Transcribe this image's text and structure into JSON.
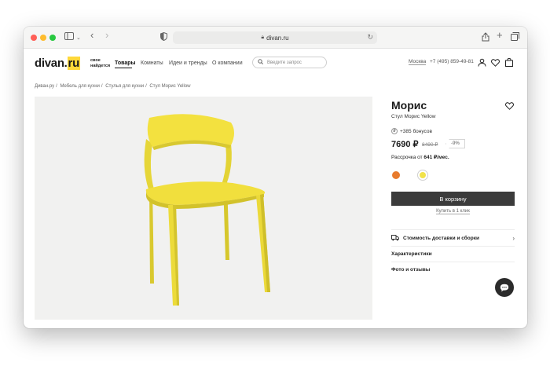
{
  "browser": {
    "url": "divan.ru"
  },
  "header": {
    "logo_main": "divan.",
    "logo_tld": "ru",
    "slogan_line1": "свое",
    "slogan_line2": "найдется",
    "nav": [
      "Товары",
      "Комнаты",
      "Идеи и тренды",
      "О компании"
    ],
    "search_placeholder": "Введите запрос",
    "city": "Москва",
    "phone": "+7 (495) 859-49-81"
  },
  "breadcrumb": [
    "Диван.ру",
    "Мебель для кухни",
    "Стулья для кухни",
    "Стул Морис Yellow"
  ],
  "product": {
    "title": "Морис",
    "subtitle": "Стул Морис Yellow",
    "bonus": "+385 бонусов",
    "price": "7690 ₽",
    "old_price": "8490 ₽",
    "discount": "-9%",
    "installment_prefix": "Рассрочка от ",
    "installment_value": "641 ₽/мес.",
    "swatch_colors": [
      "#e87b2d",
      "#ffffff",
      "#f1e24a"
    ],
    "cart_button": "В корзину",
    "one_click": "Купить в 1 клик",
    "delivery_label": "Стоимость доставки и сборки",
    "specs_label": "Характеристики",
    "reviews_label": "Фото и отзывы"
  },
  "colors": {
    "chair": "#f3e13f",
    "accent": "#ffd83a",
    "button": "#3b3b3b"
  }
}
